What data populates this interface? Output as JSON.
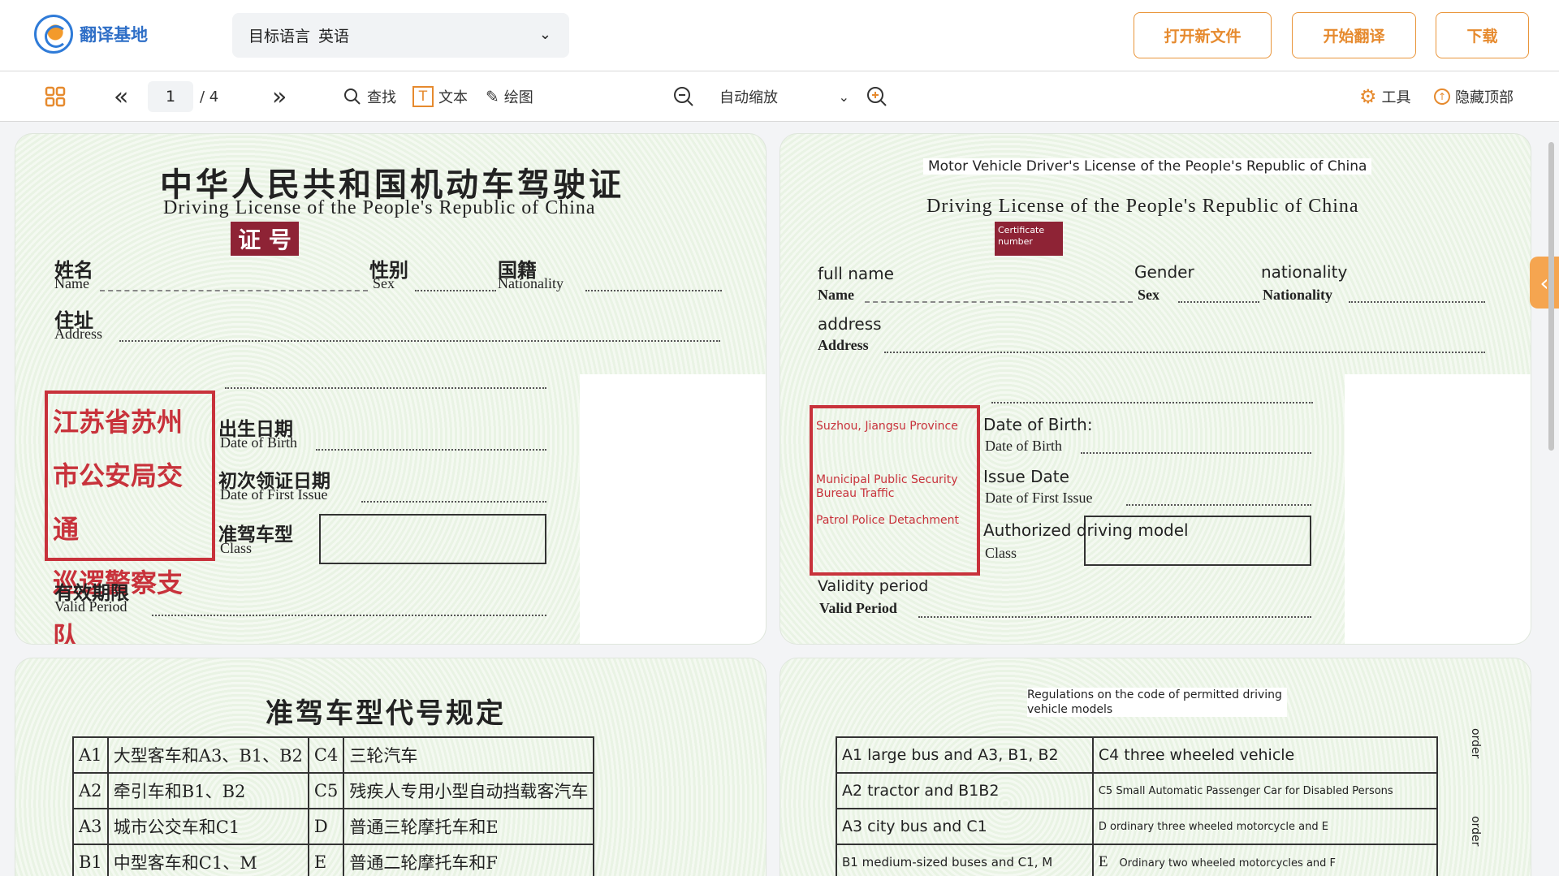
{
  "app": {
    "logo_text": "翻译基地"
  },
  "header": {
    "lang_label": "目标语言",
    "lang_value": "英语",
    "open_file": "打开新文件",
    "start_translate": "开始翻译",
    "download": "下载"
  },
  "toolbar": {
    "page_current": "1",
    "page_total": "/ 4",
    "find": "查找",
    "text": "文本",
    "draw": "绘图",
    "zoom_mode": "自动缩放",
    "tools": "工具",
    "hide_top": "隐藏顶部"
  },
  "page1": {
    "title_cn": "中华人民共和国机动车驾驶证",
    "title_en": "Driving License of the People's Republic of China",
    "cert": "证 号",
    "name_cn": "姓名",
    "name_en": "Name",
    "sex_cn": "性别",
    "sex_en": "Sex",
    "nat_cn": "国籍",
    "nat_en": "Nationality",
    "addr_cn": "住址",
    "addr_en": "Address",
    "stamp_l1": "江苏省苏州",
    "stamp_l2": "市公安局交通",
    "stamp_l3": "巡逻警察支队",
    "dob_cn": "出生日期",
    "dob_en": "Date of Birth",
    "issue_cn": "初次领证日期",
    "issue_en": "Date of First Issue",
    "class_cn": "准驾车型",
    "class_en": "Class",
    "valid_cn": "有效期限",
    "valid_en": "Valid Period"
  },
  "page2": {
    "top": "Motor Vehicle Driver's License of the People's Republic of China",
    "title_en": "Driving License of the People's Republic of China",
    "cert": "Certificate number",
    "name_tr": "full name",
    "name_en": "Name",
    "sex_tr": "Gender",
    "sex_en": "Sex",
    "nat_tr": "nationality",
    "nat_en": "Nationality",
    "addr_tr": "address",
    "addr_en": "Address",
    "stamp_l1": "Suzhou, Jiangsu Province",
    "stamp_l2": "Municipal Public Security Bureau Traffic",
    "stamp_l3": "Patrol Police Detachment",
    "dob_tr": "Date of Birth:",
    "dob_en": "Date of Birth",
    "issue_tr": "Issue Date",
    "issue_en": "Date of First Issue",
    "class_tr": "Authorized driving model",
    "class_en": "Class",
    "valid_tr": "Validity period",
    "valid_en": "Valid Period"
  },
  "page3": {
    "title": "准驾车型代号规定",
    "rows": [
      [
        "A1",
        "大型客车和A3、B1、B2",
        "C4",
        "三轮汽车"
      ],
      [
        "A2",
        "牵引车和B1、B2",
        "C5",
        "残疾人专用小型自动挡载客汽车"
      ],
      [
        "A3",
        "城市公交车和C1",
        "D",
        "普通三轮摩托车和E"
      ],
      [
        "B1",
        "中型客车和C1、M",
        "E",
        "普通二轮摩托车和F"
      ]
    ]
  },
  "page4": {
    "title": "Regulations on the code of permitted driving vehicle models",
    "side": "order",
    "rows": [
      [
        "A1 large bus and A3, B1, B2",
        "C4 three wheeled vehicle"
      ],
      [
        "A2 tractor and B1B2",
        "C5 Small Automatic Passenger Car for Disabled Persons"
      ],
      [
        "A3 city bus and C1",
        "D ordinary three wheeled motorcycle and E"
      ],
      [
        "B1 medium-sized buses and C1, M",
        "Ordinary two wheeled motorcycles and F"
      ]
    ],
    "e_code": "E"
  }
}
